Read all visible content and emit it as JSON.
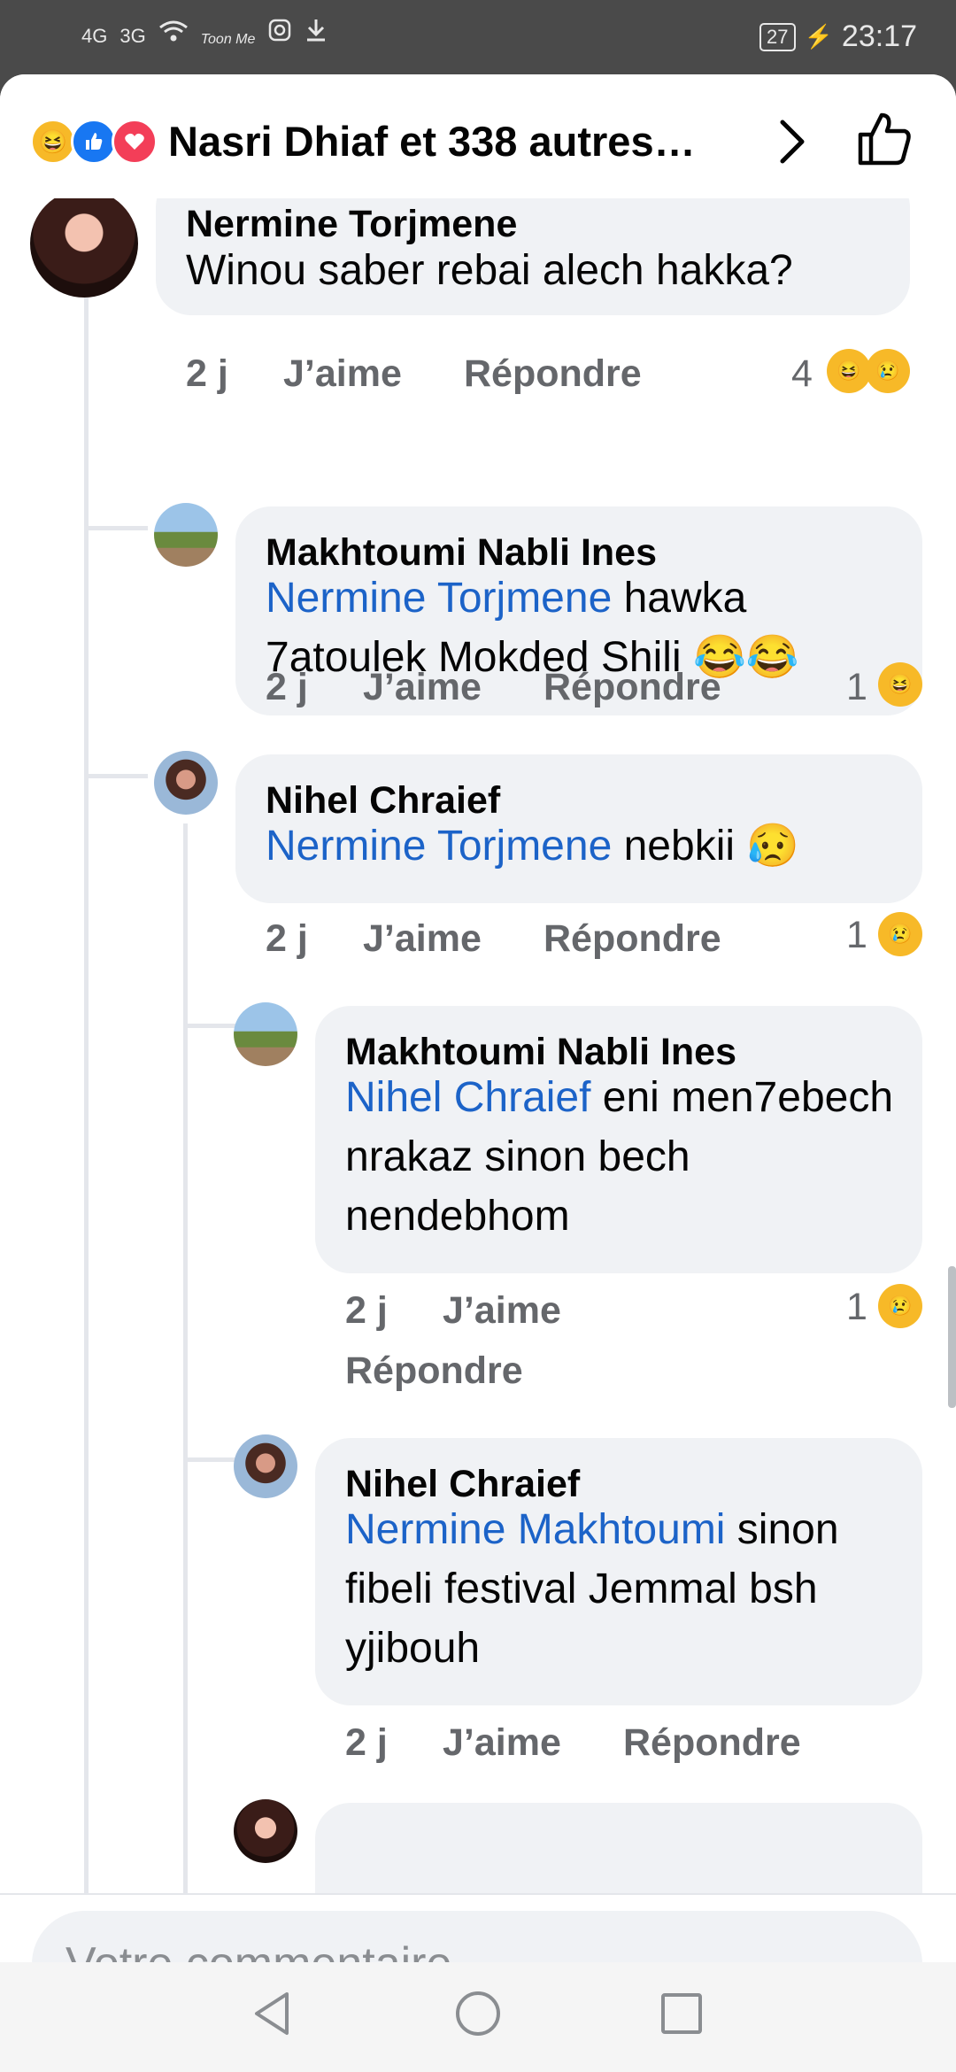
{
  "status_bar": {
    "left_icons": [
      "4G",
      "3G",
      "wifi-icon",
      "Toon Me",
      "instagram-icon",
      "download-icon"
    ],
    "battery": "27",
    "time": "23:17"
  },
  "header": {
    "title": "Nasri Dhiaf et 338 autres…",
    "reactions": [
      "haha",
      "like",
      "love"
    ]
  },
  "comments": [
    {
      "author": "Nermine Torjmene",
      "mention": "",
      "text": "Winou saber rebai alech hakka?",
      "time": "2 j",
      "like": "J’aime",
      "reply": "Répondre",
      "reaction_count": "4",
      "reactions": [
        "haha",
        "sad"
      ]
    },
    {
      "author": "Makhtoumi Nabli Ines",
      "mention": "Nermine Torjmene",
      "text": " hawka 7atoulek Mokded Shili 😂😂",
      "time": "2 j",
      "like": "J’aime",
      "reply": "Répondre",
      "reaction_count": "1",
      "reactions": [
        "haha"
      ]
    },
    {
      "author": "Nihel Chraief",
      "mention": "Nermine Torjmene",
      "text": " nebkii 😥",
      "time": "2 j",
      "like": "J’aime",
      "reply": "Répondre",
      "reaction_count": "1",
      "reactions": [
        "sad"
      ]
    },
    {
      "author": "Makhtoumi Nabli Ines",
      "mention": "Nihel Chraief",
      "text": " eni men7ebech nrakaz sinon bech nendebhom",
      "time": "2 j",
      "like": "J’aime",
      "reply": "Répondre",
      "reaction_count": "1",
      "reactions": [
        "sad"
      ]
    },
    {
      "author": "Nihel Chraief",
      "mention": "Nermine Makhtoumi",
      "text": " sinon fibeli festival Jemmal bsh yjibouh",
      "time": "2 j",
      "like": "J’aime",
      "reply": "Répondre",
      "reaction_count": "",
      "reactions": []
    }
  ],
  "composer": {
    "placeholder": "Votre commentaire…"
  },
  "colors": {
    "mention": "#1c63c8",
    "bubble": "#f0f2f5",
    "meta": "#65676b",
    "haha": "#f7b928",
    "like": "#1877f2",
    "love": "#f33e58"
  }
}
